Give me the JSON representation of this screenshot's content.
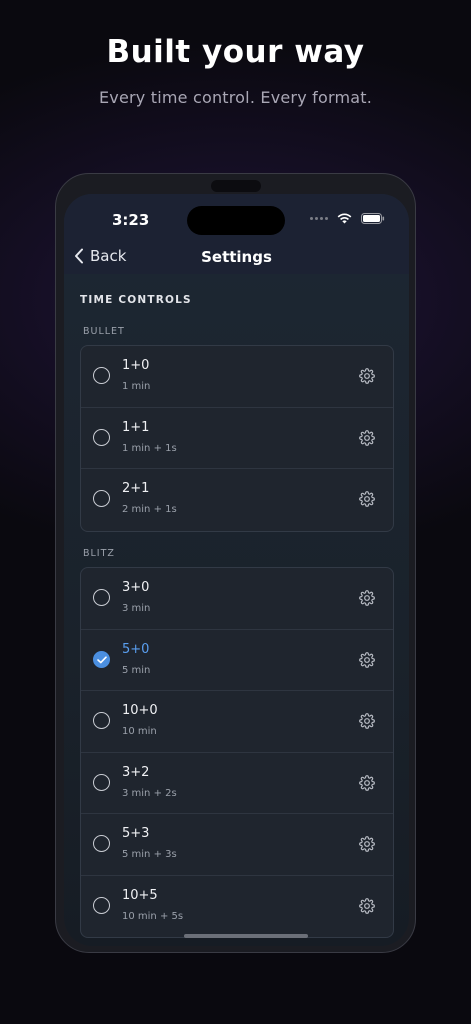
{
  "headline": "Built your way",
  "subline": "Every time control. Every format.",
  "status": {
    "time": "3:23"
  },
  "nav": {
    "back_label": "Back",
    "title": "Settings"
  },
  "section_title": "TIME CONTROLS",
  "groups": [
    {
      "label": "BULLET",
      "items": [
        {
          "main": "1+0",
          "sub": "1 min",
          "selected": false
        },
        {
          "main": "1+1",
          "sub": "1 min + 1s",
          "selected": false
        },
        {
          "main": "2+1",
          "sub": "2 min + 1s",
          "selected": false
        }
      ]
    },
    {
      "label": "BLITZ",
      "items": [
        {
          "main": "3+0",
          "sub": "3 min",
          "selected": false
        },
        {
          "main": "5+0",
          "sub": "5 min",
          "selected": true
        },
        {
          "main": "10+0",
          "sub": "10 min",
          "selected": false
        },
        {
          "main": "3+2",
          "sub": "3 min + 2s",
          "selected": false
        },
        {
          "main": "5+3",
          "sub": "5 min + 3s",
          "selected": false
        },
        {
          "main": "10+5",
          "sub": "10 min + 5s",
          "selected": false
        }
      ]
    }
  ],
  "colors": {
    "accent": "#4b8fe0"
  },
  "icons": [
    "chevron-left-icon",
    "wifi-icon",
    "battery-icon",
    "gear-icon",
    "check-icon"
  ]
}
